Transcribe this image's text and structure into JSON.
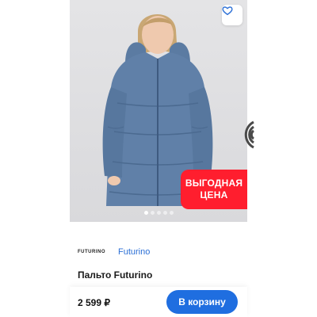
{
  "product": {
    "title": "Пальто Futurino",
    "brand_logo": "FUTURINO",
    "brand_name": "Futurino",
    "price": "2 599 ₽",
    "promo_badge": {
      "line1": "ВЫГОДНАЯ",
      "line2": "ЦЕНА"
    },
    "image_dots": {
      "count": 5,
      "active_index": 0
    }
  },
  "actions": {
    "add_to_cart_label": "В корзину",
    "favorite_icon": "heart-icon"
  },
  "colors": {
    "accent_blue": "#1f6ee0",
    "link_blue": "#2b6fd6",
    "promo_red": "#ff1e2e",
    "coat_blue": "#5f7fa6"
  }
}
